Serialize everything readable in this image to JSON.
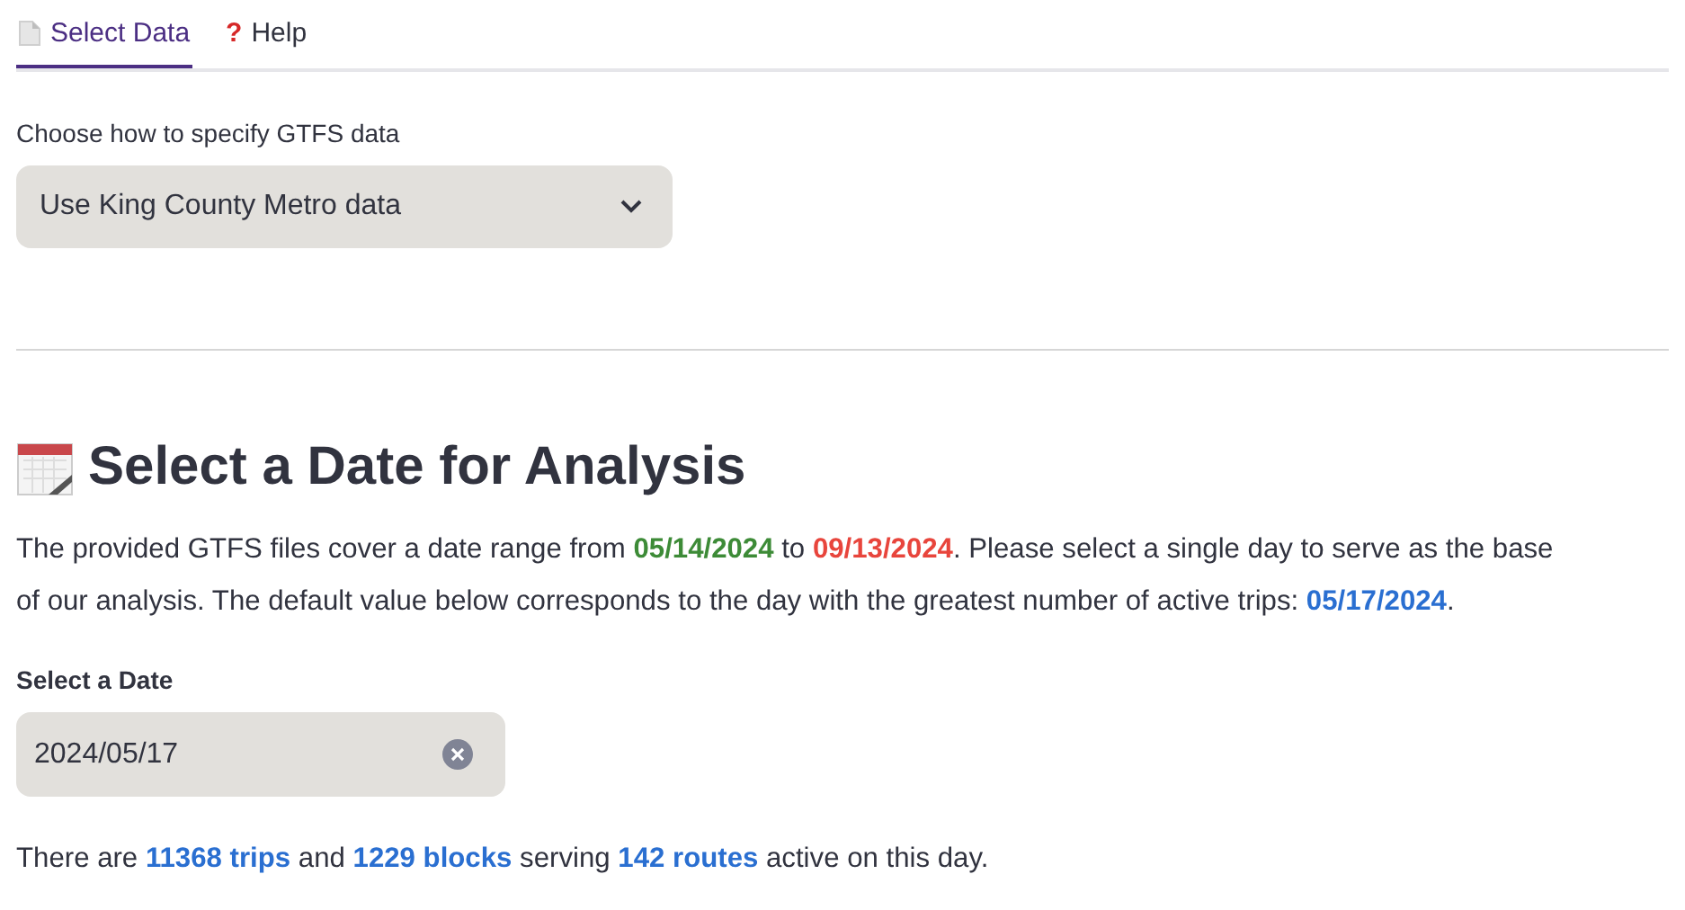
{
  "tabs": [
    {
      "label": "Select Data",
      "selected": true,
      "kind": "document"
    },
    {
      "label": "Help",
      "selected": false,
      "kind": "question",
      "icon": "?"
    }
  ],
  "source_select": {
    "label": "Choose how to specify GTFS data",
    "value": "Use King County Metro data"
  },
  "heading": {
    "title": "Select a Date for Analysis",
    "kind": "calendar"
  },
  "intro": {
    "lines": [
      [
        {
          "text": "The provided GTFS files cover a date range from "
        },
        {
          "text": "05/14/2024",
          "color": "#3d8b37"
        },
        {
          "text": " to "
        },
        {
          "text": "09/13/2024",
          "color": "#e8453c"
        },
        {
          "text": ". Please select a single day to serve as the base"
        }
      ],
      [
        {
          "text": "of our analysis. The default value below corresponds to the day with the greatest number of active trips: "
        },
        {
          "text": "05/17/2024",
          "color": "#2a6fd1"
        },
        {
          "text": "."
        }
      ]
    ]
  },
  "date_input": {
    "label": "Select a Date",
    "value": "2024/05/17"
  },
  "summary": [
    {
      "text": "There are "
    },
    {
      "text": "11368 trips",
      "color": "#2a6fd1"
    },
    {
      "text": " and "
    },
    {
      "text": "1229 blocks",
      "color": "#2a6fd1"
    },
    {
      "text": " serving "
    },
    {
      "text": "142 routes",
      "color": "#2a6fd1"
    },
    {
      "text": " active on this day."
    }
  ]
}
